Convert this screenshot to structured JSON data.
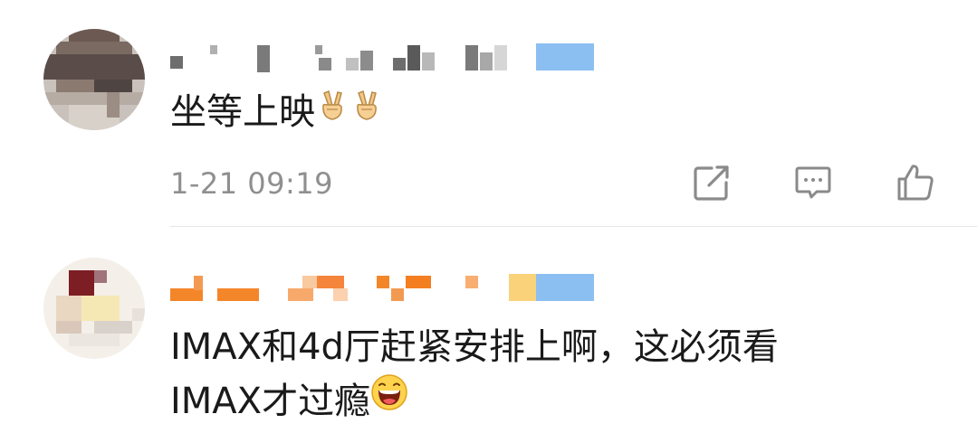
{
  "comments": [
    {
      "username": "",
      "text": "坐等上映",
      "emojis": [
        "victory-hand-emoji",
        "victory-hand-emoji"
      ],
      "timestamp": "1-21 09:19",
      "actions": [
        "share-icon",
        "comment-icon",
        "like-icon"
      ]
    },
    {
      "username": "",
      "text_line1": "IMAX和4d厅赶紧安排上啊，这必须看",
      "text_line2": "IMAX才过瘾",
      "emojis": [
        "laughing-face-emoji"
      ]
    }
  ],
  "colors": {
    "text": "#1a1a1a",
    "meta": "#8f8f8f",
    "icon": "#8a8a8a",
    "divider": "#e6e6e6",
    "username_orange": "#f47f20",
    "badge_blue": "#7fb5ee"
  }
}
